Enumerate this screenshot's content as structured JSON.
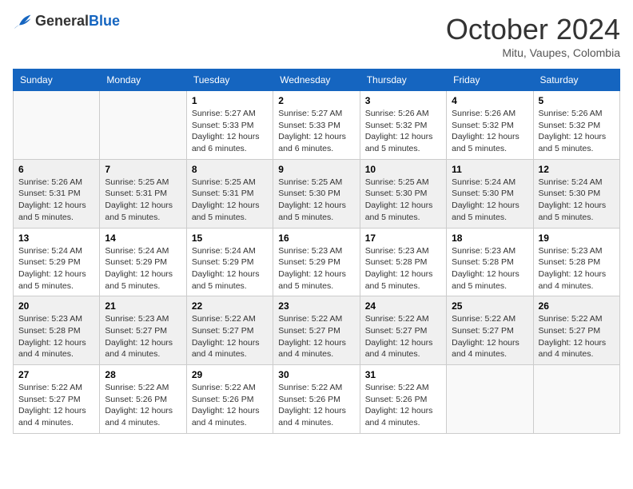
{
  "logo": {
    "general": "General",
    "blue": "Blue"
  },
  "title": "October 2024",
  "location": "Mitu, Vaupes, Colombia",
  "days_of_week": [
    "Sunday",
    "Monday",
    "Tuesday",
    "Wednesday",
    "Thursday",
    "Friday",
    "Saturday"
  ],
  "weeks": [
    [
      {
        "day": "",
        "content": ""
      },
      {
        "day": "",
        "content": ""
      },
      {
        "day": "1",
        "content": "Sunrise: 5:27 AM\nSunset: 5:33 PM\nDaylight: 12 hours and 6 minutes."
      },
      {
        "day": "2",
        "content": "Sunrise: 5:27 AM\nSunset: 5:33 PM\nDaylight: 12 hours and 6 minutes."
      },
      {
        "day": "3",
        "content": "Sunrise: 5:26 AM\nSunset: 5:32 PM\nDaylight: 12 hours and 5 minutes."
      },
      {
        "day": "4",
        "content": "Sunrise: 5:26 AM\nSunset: 5:32 PM\nDaylight: 12 hours and 5 minutes."
      },
      {
        "day": "5",
        "content": "Sunrise: 5:26 AM\nSunset: 5:32 PM\nDaylight: 12 hours and 5 minutes."
      }
    ],
    [
      {
        "day": "6",
        "content": "Sunrise: 5:26 AM\nSunset: 5:31 PM\nDaylight: 12 hours and 5 minutes."
      },
      {
        "day": "7",
        "content": "Sunrise: 5:25 AM\nSunset: 5:31 PM\nDaylight: 12 hours and 5 minutes."
      },
      {
        "day": "8",
        "content": "Sunrise: 5:25 AM\nSunset: 5:31 PM\nDaylight: 12 hours and 5 minutes."
      },
      {
        "day": "9",
        "content": "Sunrise: 5:25 AM\nSunset: 5:30 PM\nDaylight: 12 hours and 5 minutes."
      },
      {
        "day": "10",
        "content": "Sunrise: 5:25 AM\nSunset: 5:30 PM\nDaylight: 12 hours and 5 minutes."
      },
      {
        "day": "11",
        "content": "Sunrise: 5:24 AM\nSunset: 5:30 PM\nDaylight: 12 hours and 5 minutes."
      },
      {
        "day": "12",
        "content": "Sunrise: 5:24 AM\nSunset: 5:30 PM\nDaylight: 12 hours and 5 minutes."
      }
    ],
    [
      {
        "day": "13",
        "content": "Sunrise: 5:24 AM\nSunset: 5:29 PM\nDaylight: 12 hours and 5 minutes."
      },
      {
        "day": "14",
        "content": "Sunrise: 5:24 AM\nSunset: 5:29 PM\nDaylight: 12 hours and 5 minutes."
      },
      {
        "day": "15",
        "content": "Sunrise: 5:24 AM\nSunset: 5:29 PM\nDaylight: 12 hours and 5 minutes."
      },
      {
        "day": "16",
        "content": "Sunrise: 5:23 AM\nSunset: 5:29 PM\nDaylight: 12 hours and 5 minutes."
      },
      {
        "day": "17",
        "content": "Sunrise: 5:23 AM\nSunset: 5:28 PM\nDaylight: 12 hours and 5 minutes."
      },
      {
        "day": "18",
        "content": "Sunrise: 5:23 AM\nSunset: 5:28 PM\nDaylight: 12 hours and 5 minutes."
      },
      {
        "day": "19",
        "content": "Sunrise: 5:23 AM\nSunset: 5:28 PM\nDaylight: 12 hours and 4 minutes."
      }
    ],
    [
      {
        "day": "20",
        "content": "Sunrise: 5:23 AM\nSunset: 5:28 PM\nDaylight: 12 hours and 4 minutes."
      },
      {
        "day": "21",
        "content": "Sunrise: 5:23 AM\nSunset: 5:27 PM\nDaylight: 12 hours and 4 minutes."
      },
      {
        "day": "22",
        "content": "Sunrise: 5:22 AM\nSunset: 5:27 PM\nDaylight: 12 hours and 4 minutes."
      },
      {
        "day": "23",
        "content": "Sunrise: 5:22 AM\nSunset: 5:27 PM\nDaylight: 12 hours and 4 minutes."
      },
      {
        "day": "24",
        "content": "Sunrise: 5:22 AM\nSunset: 5:27 PM\nDaylight: 12 hours and 4 minutes."
      },
      {
        "day": "25",
        "content": "Sunrise: 5:22 AM\nSunset: 5:27 PM\nDaylight: 12 hours and 4 minutes."
      },
      {
        "day": "26",
        "content": "Sunrise: 5:22 AM\nSunset: 5:27 PM\nDaylight: 12 hours and 4 minutes."
      }
    ],
    [
      {
        "day": "27",
        "content": "Sunrise: 5:22 AM\nSunset: 5:27 PM\nDaylight: 12 hours and 4 minutes."
      },
      {
        "day": "28",
        "content": "Sunrise: 5:22 AM\nSunset: 5:26 PM\nDaylight: 12 hours and 4 minutes."
      },
      {
        "day": "29",
        "content": "Sunrise: 5:22 AM\nSunset: 5:26 PM\nDaylight: 12 hours and 4 minutes."
      },
      {
        "day": "30",
        "content": "Sunrise: 5:22 AM\nSunset: 5:26 PM\nDaylight: 12 hours and 4 minutes."
      },
      {
        "day": "31",
        "content": "Sunrise: 5:22 AM\nSunset: 5:26 PM\nDaylight: 12 hours and 4 minutes."
      },
      {
        "day": "",
        "content": ""
      },
      {
        "day": "",
        "content": ""
      }
    ]
  ]
}
